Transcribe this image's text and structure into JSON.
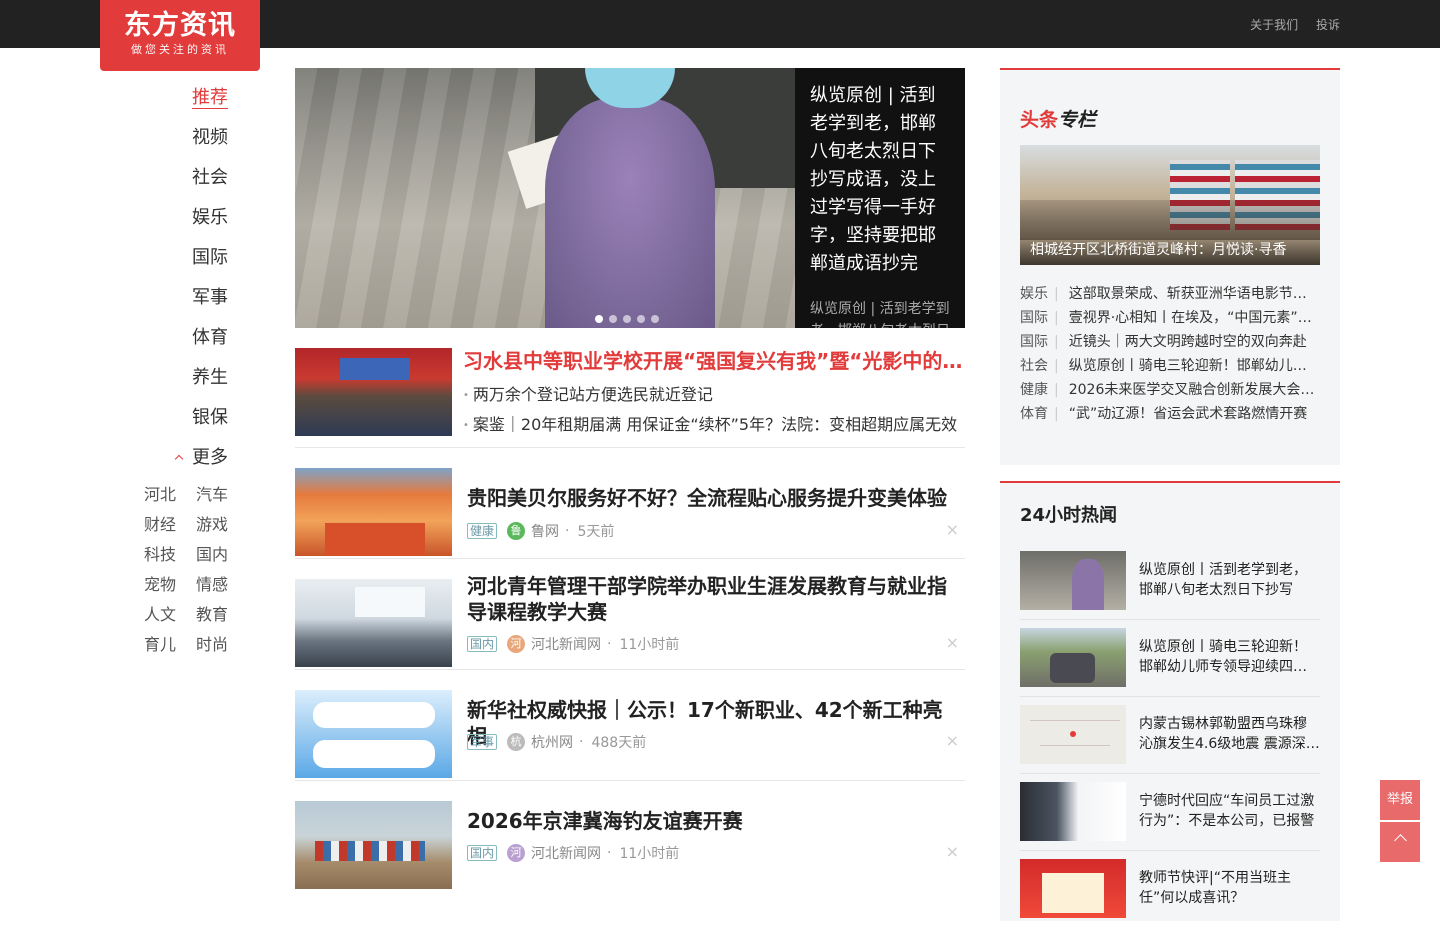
{
  "header": {
    "logo_main": "东方资讯",
    "logo_tagline": "做您关注的资讯",
    "links": [
      "关于我们",
      "投诉"
    ]
  },
  "nav": {
    "items": [
      "推荐",
      "视频",
      "社会",
      "娱乐",
      "国际",
      "军事",
      "体育",
      "养生",
      "银保"
    ],
    "active_index": 0,
    "more_label": "更多",
    "sub_items": [
      [
        "河北",
        "汽车"
      ],
      [
        "财经",
        "游戏"
      ],
      [
        "科技",
        "国内"
      ],
      [
        "宠物",
        "情感"
      ],
      [
        "人文",
        "教育"
      ],
      [
        "育儿",
        "时尚"
      ]
    ]
  },
  "hero": {
    "title": "纵览原创 | 活到老学到老，邯郸八旬老太烈日下抄写成语，没上过学写得一手好字，坚持要把邯郸道成语抄完",
    "subtitle": "纵览原创 | 活到老学到老，邯郸八旬老太烈日下"
  },
  "feed": {
    "top_item": {
      "title": "习水县中等职业学校开展“强国复兴有我”暨“光影中的…",
      "subs": [
        "两万余个登记站方便选民就近登记",
        "案鉴｜20年租期届满 用保证金“续杯”5年？法院：变相超期应属无效"
      ]
    },
    "items": [
      {
        "title": "贵阳美贝尔服务好不好？全流程贴心服务提升变美体验",
        "tag": "健康",
        "src_icon": "鲁",
        "source": "鲁网",
        "time": "5天前",
        "icon_color": "#5cb85c"
      },
      {
        "title": "河北青年管理干部学院举办职业生涯发展教育与就业指导课程教学大赛",
        "tag": "国内",
        "src_icon": "河",
        "source": "河北新闻网",
        "time": "11小时前",
        "icon_color": "#e8a87c"
      },
      {
        "title": "新华社权威快报｜公示！17个新职业、42个新工种亮相",
        "tag": "军事",
        "src_icon": "杭",
        "source": "杭州网",
        "time": "488天前",
        "icon_color": "#bbbbbb"
      },
      {
        "title": "2026年京津冀海钓友谊赛开赛",
        "tag": "国内",
        "src_icon": "河",
        "source": "河北新闻网",
        "time": "11小时前",
        "icon_color": "#b9a0d0"
      }
    ],
    "close_glyph": "×"
  },
  "headline_column": {
    "logo_a": "头条",
    "logo_b": "专栏",
    "feature_caption": "相城经开区北桥街道灵峰村：月悦读·寻香",
    "list": [
      {
        "cat": "娱乐",
        "text": "这部取景荣成、斩获亚洲华语电影节两…"
      },
      {
        "cat": "国际",
        "text": "壹视界·心相知丨在埃及，“中国元素”见…"
      },
      {
        "cat": "国际",
        "text": "近镜头｜两大文明跨越时空的双向奔赴"
      },
      {
        "cat": "社会",
        "text": "纵览原创丨骑电三轮迎新！邯郸幼儿师…"
      },
      {
        "cat": "健康",
        "text": "2026未来医学交叉融合创新发展大会…"
      },
      {
        "cat": "体育",
        "text": "“武”动辽源！省运会武术套路燃情开赛"
      }
    ]
  },
  "hot24": {
    "title": "24小时热闻",
    "items": [
      "纵览原创丨活到老学到老，邯郸八旬老太烈日下抄写成…",
      "纵览原创丨骑电三轮迎新！邯郸幼儿师专领导迎续四…",
      "内蒙古锡林郭勒盟西乌珠穆沁旗发生4.6级地震 震源深…",
      "宁德时代回应“车间员工过激行为”：不是本公司，已报警",
      "教师节快评|“不用当班主任”何以成喜讯？"
    ]
  },
  "float": {
    "report_label": "举报"
  }
}
